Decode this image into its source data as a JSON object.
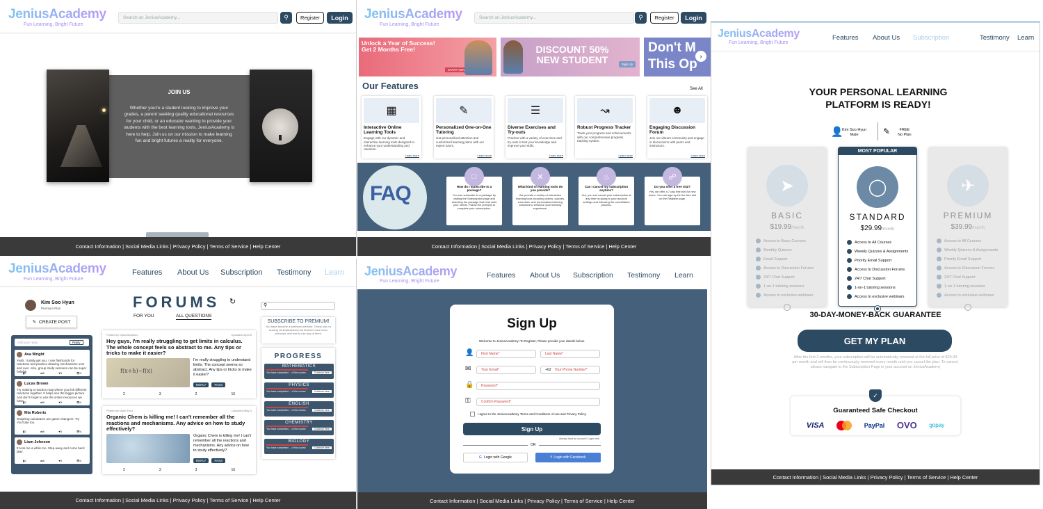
{
  "brand": {
    "name": "JeniusAcademy",
    "tagline": "Fun Learning, Bright Future"
  },
  "header": {
    "search_placeholder": "Search on JeniusAcademy...",
    "register": "Register",
    "login": "Login"
  },
  "nav": {
    "features": "Features",
    "about": "About Us",
    "subscription": "Subscription",
    "testimony": "Testimony",
    "learn": "Learn"
  },
  "footer": {
    "text": "Contact Information | Social Media Links | Privacy Policy | Terms of Service | Help Center"
  },
  "join": {
    "title": "JOIN US",
    "body": "Whether you're a student looking to improve your grades, a parent seeking quality educational resources for your child, or an educator wanting to provide your students with the best learning tools, JeniusAcademy is here to help. Join us on our mission to make learning fun and bright futures a reality for everyone."
  },
  "banners": {
    "b1_title": "Unlock a Year of Success! Get 2 Months Free!",
    "b1_cta": "START NOW",
    "b2_title": "DISCOUNT 50% NEW STUDENT",
    "b2_cta": "Sign Up",
    "b3_title": "Don't M This Op"
  },
  "features": {
    "title": "Our Features",
    "see_all": "See All",
    "more": "Learn more",
    "items": [
      {
        "title": "Interactive Online Learning Tools",
        "desc": "Engage with our dynamic and interactive learning tools designed to enhance your understanding and retention.",
        "icon": "grid-icons"
      },
      {
        "title": "Personalized One-on-One Tutoring",
        "desc": "Get personalized attention and customized learning plans with our expert tutors.",
        "icon": "tutor-icon"
      },
      {
        "title": "Diverse Exercises and Try-outs",
        "desc": "Practice with a variety of exercises and try-outs to test your knowledge and improve your skills.",
        "icon": "exercise-icon"
      },
      {
        "title": "Robust Progress Tracker",
        "desc": "Track your progress and achievements with our comprehensive progress tracking system.",
        "icon": "tracker-icon"
      },
      {
        "title": "Engaging Discussion Forum",
        "desc": "Join our vibrant community and engage in discussions with peers and instructors.",
        "icon": "forum-icon"
      }
    ]
  },
  "faq": {
    "label": "FAQ",
    "items": [
      {
        "q": "How do I subscribe to a package?",
        "a": "You can subscribe to a package by visiting the Subscription page and selecting the package that best suits your needs. Follow the prompts to complete your subscription."
      },
      {
        "q": "What kind of learning tools do you provide?",
        "a": "We provide a variety of interactive learning tools including videos, quizzes, exercises, and personalized tutoring sessions to enhance your learning experience."
      },
      {
        "q": "Can I cancel my subscription anytime?",
        "a": "Yes, you can cancel your subscription at any time by going to your account settings and following the cancellation process."
      },
      {
        "q": "Do you offer a free trial?",
        "a": "Yes, we offer a 7-day free trial for new users. You can sign up for the free trial on the Register page."
      }
    ]
  },
  "plans": {
    "title": "YOUR PERSONAL LEARNING PLATFORM IS READY!",
    "user_name": "Kim Soo Hyun",
    "user_gender": "Male",
    "plan_free": "FREE",
    "plan_none": "No Plan",
    "most_popular": "MOST POPULAR",
    "per": "/month",
    "basic": {
      "name": "BASIC",
      "price": "$19.99",
      "features": [
        "Access to Basic Courses",
        "Monthly Quizzes",
        "Email Support",
        "Access to Discussion Forums",
        "24/7 Chat Support",
        "1-on-1 tutoring sessions",
        "Access to exclusive webinars"
      ]
    },
    "standard": {
      "name": "STANDARD",
      "price": "$29.99",
      "features": [
        "Access to All Courses",
        "Weekly Quizzes & Assignments",
        "Priority Email Support",
        "Access to Discussion Forums",
        "24/7 Chat Support",
        "1-on-1 tutoring sessions",
        "Access to exclusive webinars"
      ]
    },
    "premium": {
      "name": "PREMIUM",
      "price": "$39.99",
      "features": [
        "Access to All Courses",
        "Weekly Quizzes & Assignments",
        "Priority Email Support",
        "Access to Discussion Forums",
        "24/7 Chat Support",
        "1-on-1 tutoring sessions",
        "Access to exclusive webinars"
      ]
    },
    "guarantee": "30-DAY-MONEY-BACK GUARANTEE",
    "cta": "GET MY PLAN",
    "note": "After the first 3 months, your subscription will be automatically renewed at the full price of $29.99 per month and will then be continuously renewed every month until you cancel the plan. To cancel, please navigate to the Subscription Page in your account on JeniusAcademy",
    "checkout": "Guaranteed Safe Checkout",
    "pay": [
      "VISA",
      "Mastercard",
      "PayPal",
      "OVO",
      "gopay"
    ]
  },
  "forums": {
    "title": "FORUMS",
    "tab_you": "FOR YOU",
    "tab_all": "ALL QUESTIONS",
    "user": "Kim Soo Hyun",
    "user_plan": "Premium Plan",
    "create": "CREATE POST",
    "reply_ph": "Add your reply",
    "reply_btn": "Reply",
    "comments": [
      {
        "name": "Ava Wright",
        "text": "Yeah, I totally get you. I use flashcards for reactions and practice drawing mechanisms over and over. Also, group study sessions can be super helpful!"
      },
      {
        "name": "Lucas Brown",
        "text": "Try making a reaction map where you link different reactions together. It helps see the bigger picture. And don't forget to use the online resources we have."
      },
      {
        "name": "Mia Roberts",
        "text": "Graphing calculators are game-changers. Try YouTube too."
      },
      {
        "name": "Liam Johnson",
        "text": "It took me a while too. Step away and come back later."
      }
    ],
    "posts": [
      {
        "by": "Posted by Olivia Martinez",
        "when": "Uploaded April 5",
        "title": "Hey guys, I'm really struggling to get limits in calculus. The whole concept feels so abstract to me. Any tips or tricks to make it easier?",
        "text": "I'm really struggling to understand limits. The concept seems so abstract. Any tips or tricks to make it easier?",
        "s1": "2",
        "s2": "3",
        "s3": "2",
        "s4": "16"
      },
      {
        "by": "Posted by Noah Ford",
        "when": "Uploaded May 3",
        "title": "Organic Chem is killing me! I can't remember all the reactions and mechanisms. Any advice on how to study effectively?",
        "text": "Organic Chem is killing me! I can't remember all the reactions and mechanisms. Any advice on how to study effectively?",
        "s1": "2",
        "s2": "3",
        "s3": "3",
        "s4": "16"
      }
    ],
    "reply": "REPLY",
    "pass": "PASS",
    "promo_title": "SUBSCRIBE TO PREMIUM!",
    "promo_text": "You have become a premium member. Thank you for trusting JeniusAcademy! All features have been unlocked, feel free to use any of them.",
    "progress": "PROGRESS",
    "subjects": [
      {
        "name": "MATHEMATICS",
        "fill": 0.6
      },
      {
        "name": "PHYSICS",
        "fill": 0.6
      },
      {
        "name": "ENGLISH",
        "fill": 0.6
      },
      {
        "name": "CHEMISTRY",
        "fill": 0.6
      },
      {
        "name": "BIOLOGY",
        "fill": 0.6
      }
    ],
    "sub_left": "You have completed ... of the course",
    "sub_right": "Continue here"
  },
  "signup": {
    "title": "Sign Up",
    "intro": "Welcome to JeniusAcademy! To Register, Please provide your details below.",
    "first": "First Name*",
    "last": "Last Name*",
    "email": "Your Email*",
    "code": "+62",
    "phone": "Your Phone Number*",
    "password": "Password*",
    "confirm": "Confirm Password*",
    "agree": "I agree to the JeniusAcademy Terms and Conditions of use and Privacy Policy.",
    "btn": "Sign Up",
    "have": "Already have an account? Login here",
    "or": "OR",
    "google": "Login with Google",
    "facebook": "Login with Facebook"
  }
}
